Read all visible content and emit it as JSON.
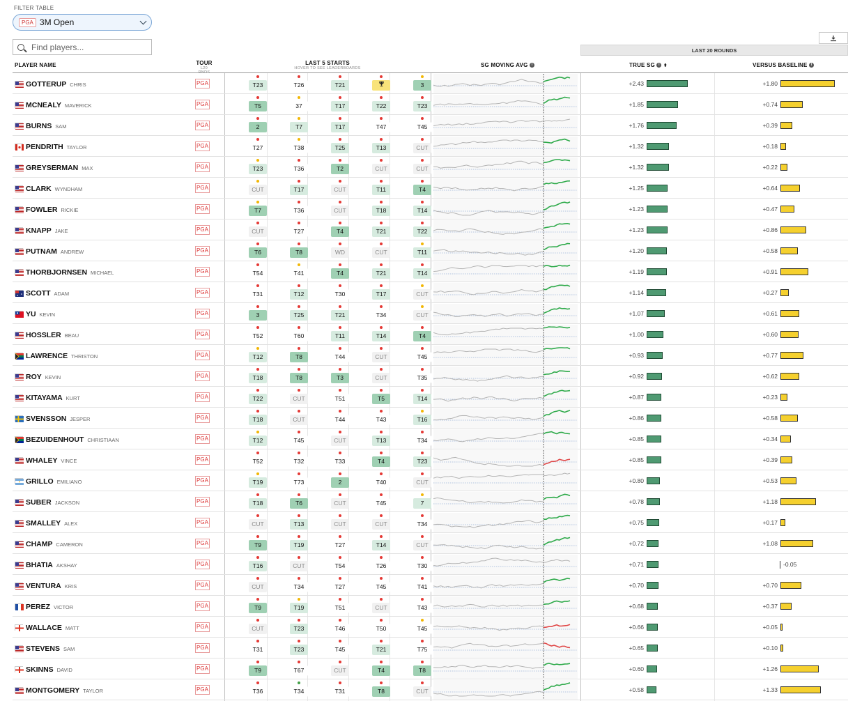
{
  "filter": {
    "label": "FILTER TABLE",
    "tour_chip": "PGA",
    "event": "3M Open"
  },
  "search": {
    "placeholder": "Find players..."
  },
  "download": {
    "icon": "download-icon"
  },
  "last20": "LAST 20 ROUNDS",
  "headers": {
    "player": "PLAYER NAME",
    "tour": "TOUR",
    "tour_sub": "L20 RNDS",
    "last5": "LAST 5 STARTS",
    "last5_sub": "HOVER TO SEE LEADERBOARDS",
    "sg_moving": "SG MOVING AVG",
    "true_sg": "TRUE SG",
    "vs_baseline": "VERSUS BASELINE"
  },
  "colors": {
    "sg_bar": "#4f9a72",
    "baseline_bar": "#f5d02e",
    "tour_red": "#d33",
    "trend_up": "#2eaa4a",
    "trend_down": "#e04848"
  },
  "players": [
    {
      "last": "GOTTERUP",
      "first": "CHRIS",
      "flag": "us",
      "tour": "PGA",
      "starts": [
        "T23",
        "T26",
        "T21",
        "WIN",
        "3"
      ],
      "shade": [
        "g",
        "n",
        "g",
        "win",
        "gd"
      ],
      "dots": [
        "r",
        "r",
        "r",
        "r",
        "y"
      ],
      "trend": "up",
      "sg": "+2.43",
      "sgv": 2.43,
      "vb": "+1.80",
      "vbv": 1.8
    },
    {
      "last": "MCNEALY",
      "first": "MAVERICK",
      "flag": "us",
      "tour": "PGA",
      "starts": [
        "T5",
        "37",
        "T17",
        "T22",
        "T23"
      ],
      "shade": [
        "gd",
        "n",
        "g",
        "g",
        "g"
      ],
      "dots": [
        "r",
        "y",
        "r",
        "r",
        "r"
      ],
      "trend": "up",
      "sg": "+1.85",
      "sgv": 1.85,
      "vb": "+0.74",
      "vbv": 0.74
    },
    {
      "last": "BURNS",
      "first": "SAM",
      "flag": "us",
      "tour": "PGA",
      "starts": [
        "2",
        "T7",
        "T17",
        "T47",
        "T45"
      ],
      "shade": [
        "gd",
        "g",
        "g",
        "n",
        "n"
      ],
      "dots": [
        "r",
        "y",
        "r",
        "r",
        "r"
      ],
      "trend": "flat",
      "sg": "+1.76",
      "sgv": 1.76,
      "vb": "+0.39",
      "vbv": 0.39
    },
    {
      "last": "PENDRITH",
      "first": "TAYLOR",
      "flag": "ca",
      "tour": "PGA",
      "starts": [
        "T27",
        "T38",
        "T25",
        "T13",
        "CUT"
      ],
      "shade": [
        "n",
        "n",
        "g",
        "g",
        "cut"
      ],
      "dots": [
        "r",
        "y",
        "r",
        "r",
        "r"
      ],
      "trend": "up",
      "sg": "+1.32",
      "sgv": 1.32,
      "vb": "+0.18",
      "vbv": 0.18
    },
    {
      "last": "GREYSERMAN",
      "first": "MAX",
      "flag": "us",
      "tour": "PGA",
      "starts": [
        "T23",
        "T36",
        "T2",
        "CUT",
        "CUT"
      ],
      "shade": [
        "g",
        "n",
        "gd",
        "cut",
        "cut"
      ],
      "dots": [
        "y",
        "r",
        "r",
        "r",
        "r"
      ],
      "trend": "up",
      "sg": "+1.32",
      "sgv": 1.32,
      "vb": "+0.22",
      "vbv": 0.22
    },
    {
      "last": "CLARK",
      "first": "WYNDHAM",
      "flag": "us",
      "tour": "PGA",
      "starts": [
        "CUT",
        "T17",
        "CUT",
        "T11",
        "T4"
      ],
      "shade": [
        "cut",
        "g",
        "cut",
        "g",
        "gd"
      ],
      "dots": [
        "y",
        "r",
        "r",
        "r",
        "r"
      ],
      "trend": "up",
      "sg": "+1.25",
      "sgv": 1.25,
      "vb": "+0.64",
      "vbv": 0.64
    },
    {
      "last": "FOWLER",
      "first": "RICKIE",
      "flag": "us",
      "tour": "PGA",
      "starts": [
        "T7",
        "T36",
        "CUT",
        "T18",
        "T14"
      ],
      "shade": [
        "gd",
        "n",
        "cut",
        "g",
        "g"
      ],
      "dots": [
        "y",
        "r",
        "r",
        "r",
        "r"
      ],
      "trend": "up",
      "sg": "+1.23",
      "sgv": 1.23,
      "vb": "+0.47",
      "vbv": 0.47
    },
    {
      "last": "KNAPP",
      "first": "JAKE",
      "flag": "us",
      "tour": "PGA",
      "starts": [
        "CUT",
        "T27",
        "T4",
        "T21",
        "T22"
      ],
      "shade": [
        "cut",
        "n",
        "gd",
        "g",
        "g"
      ],
      "dots": [
        "r",
        "r",
        "r",
        "r",
        "r"
      ],
      "trend": "up",
      "sg": "+1.23",
      "sgv": 1.23,
      "vb": "+0.86",
      "vbv": 0.86
    },
    {
      "last": "PUTNAM",
      "first": "ANDREW",
      "flag": "us",
      "tour": "PGA",
      "starts": [
        "T6",
        "T8",
        "WD",
        "CUT",
        "T11"
      ],
      "shade": [
        "gd",
        "gd",
        "cut",
        "cut",
        "g"
      ],
      "dots": [
        "r",
        "r",
        "r",
        "r",
        "y"
      ],
      "trend": "up",
      "sg": "+1.20",
      "sgv": 1.2,
      "vb": "+0.58",
      "vbv": 0.58
    },
    {
      "last": "THORBJORNSEN",
      "first": "MICHAEL",
      "flag": "us",
      "tour": "PGA",
      "starts": [
        "T54",
        "T41",
        "T4",
        "T21",
        "T14"
      ],
      "shade": [
        "n",
        "n",
        "gd",
        "g",
        "g"
      ],
      "dots": [
        "r",
        "y",
        "r",
        "r",
        "r"
      ],
      "trend": "up",
      "sg": "+1.19",
      "sgv": 1.19,
      "vb": "+0.91",
      "vbv": 0.91
    },
    {
      "last": "SCOTT",
      "first": "ADAM",
      "flag": "au",
      "tour": "PGA",
      "starts": [
        "T31",
        "T12",
        "T30",
        "T17",
        "CUT"
      ],
      "shade": [
        "n",
        "g",
        "n",
        "g",
        "cut"
      ],
      "dots": [
        "r",
        "r",
        "r",
        "r",
        "y"
      ],
      "trend": "up",
      "sg": "+1.14",
      "sgv": 1.14,
      "vb": "+0.27",
      "vbv": 0.27
    },
    {
      "last": "YU",
      "first": "KEVIN",
      "flag": "tw",
      "tour": "PGA",
      "starts": [
        "3",
        "T25",
        "T21",
        "T34",
        "CUT"
      ],
      "shade": [
        "gd",
        "g",
        "g",
        "n",
        "cut"
      ],
      "dots": [
        "r",
        "r",
        "r",
        "r",
        "y"
      ],
      "trend": "up",
      "sg": "+1.07",
      "sgv": 1.07,
      "vb": "+0.61",
      "vbv": 0.61
    },
    {
      "last": "HOSSLER",
      "first": "BEAU",
      "flag": "us",
      "tour": "PGA",
      "starts": [
        "T52",
        "T60",
        "T11",
        "T14",
        "T4"
      ],
      "shade": [
        "n",
        "n",
        "g",
        "g",
        "gd"
      ],
      "dots": [
        "r",
        "r",
        "r",
        "r",
        "r"
      ],
      "trend": "up",
      "sg": "+1.00",
      "sgv": 1.0,
      "vb": "+0.60",
      "vbv": 0.6
    },
    {
      "last": "LAWRENCE",
      "first": "THRISTON",
      "flag": "za",
      "tour": "PGA",
      "starts": [
        "T12",
        "T8",
        "T44",
        "CUT",
        "T45"
      ],
      "shade": [
        "g",
        "gd",
        "n",
        "cut",
        "n"
      ],
      "dots": [
        "y",
        "r",
        "r",
        "r",
        "r"
      ],
      "trend": "up",
      "sg": "+0.93",
      "sgv": 0.93,
      "vb": "+0.77",
      "vbv": 0.77
    },
    {
      "last": "ROY",
      "first": "KEVIN",
      "flag": "us",
      "tour": "PGA",
      "starts": [
        "T18",
        "T8",
        "T3",
        "CUT",
        "T35"
      ],
      "shade": [
        "g",
        "gd",
        "gd",
        "cut",
        "n"
      ],
      "dots": [
        "r",
        "r",
        "r",
        "r",
        "r"
      ],
      "trend": "up",
      "sg": "+0.92",
      "sgv": 0.92,
      "vb": "+0.62",
      "vbv": 0.62
    },
    {
      "last": "KITAYAMA",
      "first": "KURT",
      "flag": "us",
      "tour": "PGA",
      "starts": [
        "T22",
        "CUT",
        "T51",
        "T5",
        "T14"
      ],
      "shade": [
        "g",
        "cut",
        "n",
        "gd",
        "g"
      ],
      "dots": [
        "r",
        "r",
        "r",
        "r",
        "r"
      ],
      "trend": "up",
      "sg": "+0.87",
      "sgv": 0.87,
      "vb": "+0.23",
      "vbv": 0.23
    },
    {
      "last": "SVENSSON",
      "first": "JESPER",
      "flag": "se",
      "tour": "PGA",
      "starts": [
        "T18",
        "CUT",
        "T44",
        "T43",
        "T16"
      ],
      "shade": [
        "g",
        "cut",
        "n",
        "n",
        "g"
      ],
      "dots": [
        "r",
        "r",
        "r",
        "r",
        "y"
      ],
      "trend": "up",
      "sg": "+0.86",
      "sgv": 0.86,
      "vb": "+0.58",
      "vbv": 0.58
    },
    {
      "last": "BEZUIDENHOUT",
      "first": "CHRISTIAAN",
      "flag": "za",
      "tour": "PGA",
      "starts": [
        "T12",
        "T45",
        "CUT",
        "T13",
        "T34"
      ],
      "shade": [
        "g",
        "n",
        "cut",
        "g",
        "n"
      ],
      "dots": [
        "y",
        "r",
        "r",
        "r",
        "r"
      ],
      "trend": "up",
      "sg": "+0.85",
      "sgv": 0.85,
      "vb": "+0.34",
      "vbv": 0.34
    },
    {
      "last": "WHALEY",
      "first": "VINCE",
      "flag": "us",
      "tour": "PGA",
      "starts": [
        "T52",
        "T32",
        "T33",
        "T4",
        "T23"
      ],
      "shade": [
        "n",
        "n",
        "n",
        "gd",
        "g"
      ],
      "dots": [
        "r",
        "r",
        "r",
        "r",
        "r"
      ],
      "trend": "down",
      "sg": "+0.85",
      "sgv": 0.85,
      "vb": "+0.39",
      "vbv": 0.39
    },
    {
      "last": "GRILLO",
      "first": "EMILIANO",
      "flag": "ar",
      "tour": "PGA",
      "starts": [
        "T19",
        "T73",
        "2",
        "T40",
        "CUT"
      ],
      "shade": [
        "g",
        "n",
        "gd",
        "n",
        "cut"
      ],
      "dots": [
        "y",
        "r",
        "r",
        "r",
        "r"
      ],
      "trend": "flat",
      "sg": "+0.80",
      "sgv": 0.8,
      "vb": "+0.53",
      "vbv": 0.53
    },
    {
      "last": "SUBER",
      "first": "JACKSON",
      "flag": "us",
      "tour": "PGA",
      "starts": [
        "T18",
        "T6",
        "CUT",
        "T45",
        "7"
      ],
      "shade": [
        "g",
        "gd",
        "cut",
        "n",
        "g"
      ],
      "dots": [
        "r",
        "r",
        "r",
        "r",
        "y"
      ],
      "trend": "up",
      "sg": "+0.78",
      "sgv": 0.78,
      "vb": "+1.18",
      "vbv": 1.18
    },
    {
      "last": "SMALLEY",
      "first": "ALEX",
      "flag": "us",
      "tour": "PGA",
      "starts": [
        "CUT",
        "T13",
        "CUT",
        "CUT",
        "T34"
      ],
      "shade": [
        "cut",
        "g",
        "cut",
        "cut",
        "n"
      ],
      "dots": [
        "r",
        "r",
        "r",
        "r",
        "r"
      ],
      "trend": "up",
      "sg": "+0.75",
      "sgv": 0.75,
      "vb": "+0.17",
      "vbv": 0.17
    },
    {
      "last": "CHAMP",
      "first": "CAMERON",
      "flag": "us",
      "tour": "PGA",
      "starts": [
        "T9",
        "T19",
        "T27",
        "T14",
        "CUT"
      ],
      "shade": [
        "gd",
        "g",
        "n",
        "g",
        "cut"
      ],
      "dots": [
        "r",
        "r",
        "r",
        "r",
        "r"
      ],
      "trend": "up",
      "sg": "+0.72",
      "sgv": 0.72,
      "vb": "+1.08",
      "vbv": 1.08
    },
    {
      "last": "BHATIA",
      "first": "AKSHAY",
      "flag": "us",
      "tour": "PGA",
      "starts": [
        "T16",
        "CUT",
        "T54",
        "T26",
        "T30"
      ],
      "shade": [
        "g",
        "cut",
        "n",
        "n",
        "n"
      ],
      "dots": [
        "r",
        "r",
        "r",
        "r",
        "r"
      ],
      "trend": "flat",
      "sg": "+0.71",
      "sgv": 0.71,
      "vb": "-0.05",
      "vbv": -0.05
    },
    {
      "last": "VENTURA",
      "first": "KRIS",
      "flag": "us",
      "tour": "PGA",
      "starts": [
        "CUT",
        "T34",
        "T27",
        "T45",
        "T41"
      ],
      "shade": [
        "cut",
        "n",
        "n",
        "n",
        "n"
      ],
      "dots": [
        "r",
        "r",
        "r",
        "r",
        "r"
      ],
      "trend": "up",
      "sg": "+0.70",
      "sgv": 0.7,
      "vb": "+0.70",
      "vbv": 0.7
    },
    {
      "last": "PEREZ",
      "first": "VICTOR",
      "flag": "fr",
      "tour": "PGA",
      "starts": [
        "T9",
        "T19",
        "T51",
        "CUT",
        "T43"
      ],
      "shade": [
        "gd",
        "g",
        "n",
        "cut",
        "n"
      ],
      "dots": [
        "r",
        "y",
        "r",
        "r",
        "r"
      ],
      "trend": "up",
      "sg": "+0.68",
      "sgv": 0.68,
      "vb": "+0.37",
      "vbv": 0.37
    },
    {
      "last": "WALLACE",
      "first": "MATT",
      "flag": "en",
      "tour": "PGA",
      "starts": [
        "CUT",
        "T23",
        "T46",
        "T50",
        "T45"
      ],
      "shade": [
        "cut",
        "g",
        "n",
        "n",
        "n"
      ],
      "dots": [
        "r",
        "r",
        "r",
        "r",
        "y"
      ],
      "trend": "down",
      "sg": "+0.66",
      "sgv": 0.66,
      "vb": "+0.05",
      "vbv": 0.05
    },
    {
      "last": "STEVENS",
      "first": "SAM",
      "flag": "us",
      "tour": "PGA",
      "starts": [
        "T31",
        "T23",
        "T45",
        "T21",
        "T75"
      ],
      "shade": [
        "n",
        "g",
        "n",
        "g",
        "n"
      ],
      "dots": [
        "r",
        "r",
        "r",
        "r",
        "r"
      ],
      "trend": "down",
      "sg": "+0.65",
      "sgv": 0.65,
      "vb": "+0.10",
      "vbv": 0.1
    },
    {
      "last": "SKINNS",
      "first": "DAVID",
      "flag": "en",
      "tour": "PGA",
      "starts": [
        "T9",
        "T67",
        "CUT",
        "T4",
        "T8"
      ],
      "shade": [
        "gd",
        "n",
        "cut",
        "gd",
        "gd"
      ],
      "dots": [
        "r",
        "r",
        "r",
        "r",
        "r"
      ],
      "trend": "up",
      "sg": "+0.60",
      "sgv": 0.6,
      "vb": "+1.26",
      "vbv": 1.26
    },
    {
      "last": "MONTGOMERY",
      "first": "TAYLOR",
      "flag": "us",
      "tour": "PGA",
      "starts": [
        "T36",
        "T34",
        "T31",
        "T8",
        "CUT"
      ],
      "shade": [
        "n",
        "n",
        "n",
        "gd",
        "cut"
      ],
      "dots": [
        "r",
        "gr",
        "r",
        "r",
        "r"
      ],
      "trend": "up",
      "sg": "+0.58",
      "sgv": 0.58,
      "vb": "+1.33",
      "vbv": 1.33
    }
  ]
}
